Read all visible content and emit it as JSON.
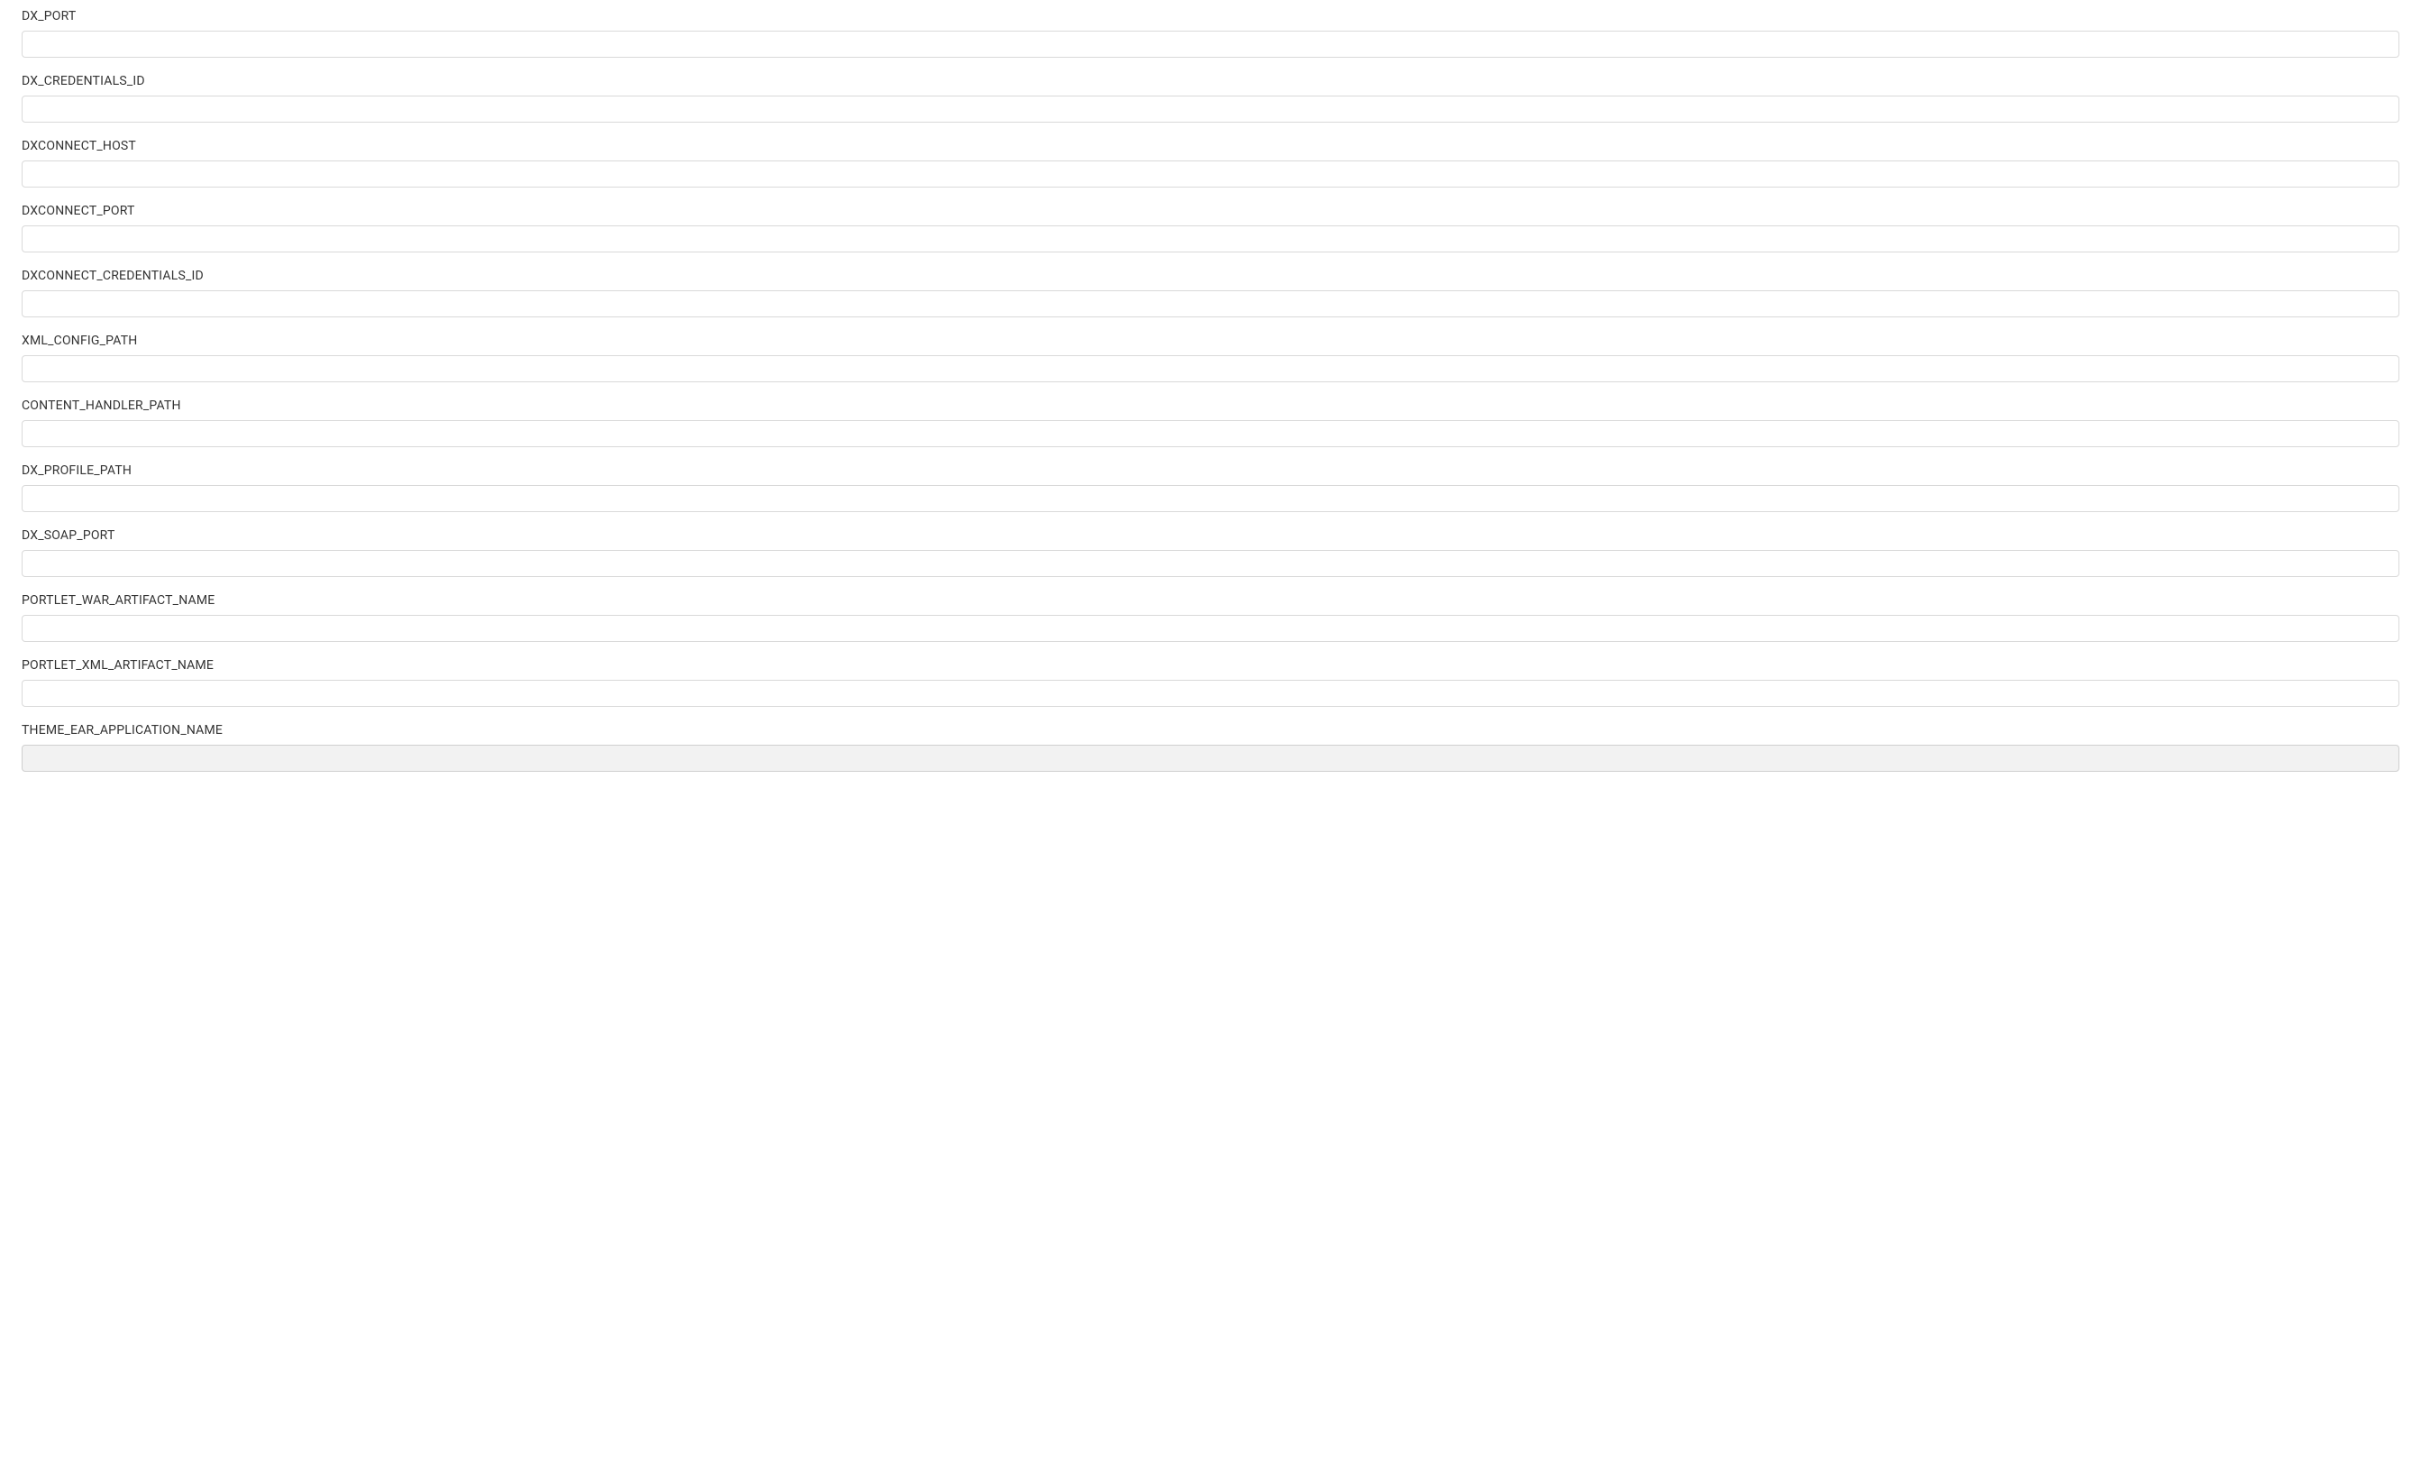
{
  "fields": [
    {
      "name": "dx-port",
      "label": "DX_PORT",
      "value": "",
      "highlight": false
    },
    {
      "name": "dx-credentials-id",
      "label": "DX_CREDENTIALS_ID",
      "value": "",
      "highlight": false
    },
    {
      "name": "dxconnect-host",
      "label": "DXCONNECT_HOST",
      "value": "",
      "highlight": false
    },
    {
      "name": "dxconnect-port",
      "label": "DXCONNECT_PORT",
      "value": "",
      "highlight": false
    },
    {
      "name": "dxconnect-credentials-id",
      "label": "DXCONNECT_CREDENTIALS_ID",
      "value": "",
      "highlight": false
    },
    {
      "name": "xml-config-path",
      "label": "XML_CONFIG_PATH",
      "value": "",
      "highlight": false
    },
    {
      "name": "content-handler-path",
      "label": "CONTENT_HANDLER_PATH",
      "value": "",
      "highlight": false
    },
    {
      "name": "dx-profile-path",
      "label": "DX_PROFILE_PATH",
      "value": "",
      "highlight": false
    },
    {
      "name": "dx-soap-port",
      "label": "DX_SOAP_PORT",
      "value": "",
      "highlight": false
    },
    {
      "name": "portlet-war-artifact-name",
      "label": "PORTLET_WAR_ARTIFACT_NAME",
      "value": "",
      "highlight": false
    },
    {
      "name": "portlet-xml-artifact-name",
      "label": "PORTLET_XML_ARTIFACT_NAME",
      "value": "",
      "highlight": false
    },
    {
      "name": "theme-ear-application-name",
      "label": "THEME_EAR_APPLICATION_NAME",
      "value": "",
      "highlight": true
    }
  ]
}
